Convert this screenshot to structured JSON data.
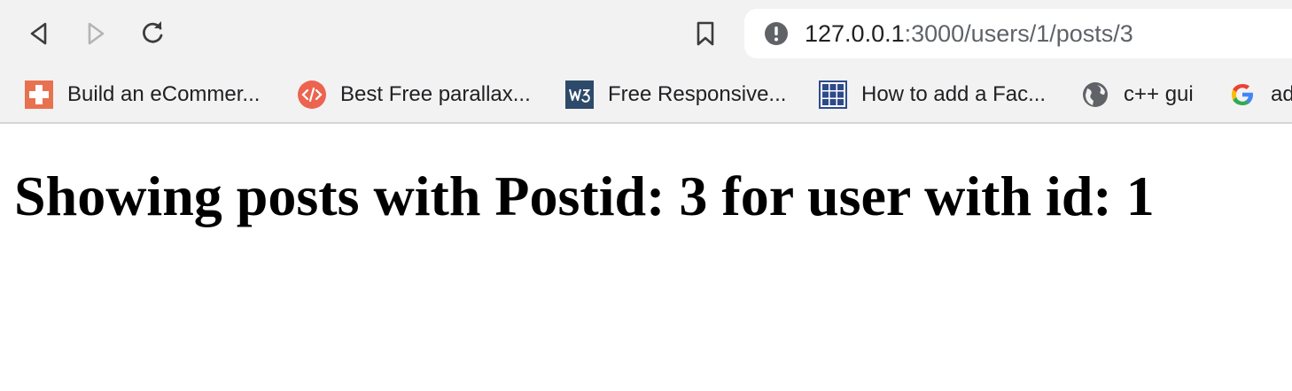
{
  "browser": {
    "nav": {
      "back_icon": "back-arrow-icon",
      "forward_icon": "forward-arrow-icon",
      "reload_icon": "reload-icon",
      "bookmark_icon": "bookmark-icon"
    },
    "address_bar": {
      "security_icon": "info-icon",
      "url_host": "127.0.0.1",
      "url_rest": ":3000/users/1/posts/3"
    },
    "bookmarks": [
      {
        "label": "Build an eCommer...",
        "icon": "red-cross-favicon-icon",
        "color": "#e8714f"
      },
      {
        "label": "Best Free parallax...",
        "icon": "code-favicon-icon",
        "color": "#ec6450"
      },
      {
        "label": "Free Responsive...",
        "icon": "w3-favicon-icon",
        "color": "#2d4a6a"
      },
      {
        "label": "How to add a Fac...",
        "icon": "grid-favicon-icon",
        "color": "#2d4a8a"
      },
      {
        "label": "c++ gui",
        "icon": "globe-icon",
        "color": "#5f6368"
      },
      {
        "label": "ad",
        "icon": "google-icon",
        "color": "#4285f4"
      }
    ]
  },
  "page": {
    "heading": "Showing posts with Postid: 3 for user with id: 1"
  },
  "colors": {
    "toolbar_bg": "#f2f2f2",
    "omnibox_bg": "#ffffff",
    "text": "#202124",
    "muted_text": "#5f6368"
  }
}
